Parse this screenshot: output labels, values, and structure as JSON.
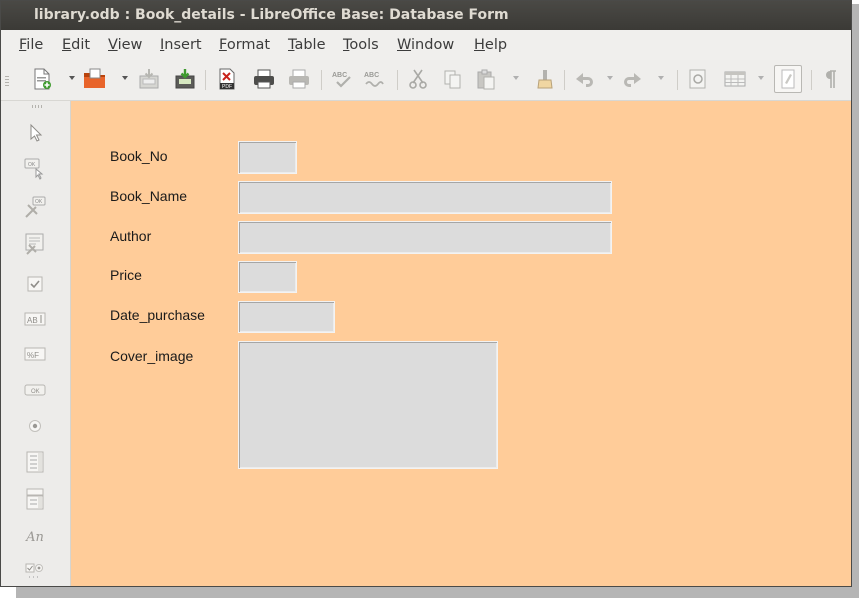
{
  "window": {
    "title": "library.odb : Book_details - LibreOffice Base: Database Form"
  },
  "menubar": {
    "items": [
      "File",
      "Edit",
      "View",
      "Insert",
      "Format",
      "Table",
      "Tools",
      "Window",
      "Help"
    ]
  },
  "toolbar": {
    "buttons": [
      "new-document",
      "open",
      "save",
      "save-export",
      "export-pdf",
      "print",
      "print-preview",
      "spellcheck",
      "autospellcheck",
      "cut",
      "copy",
      "paste",
      "clone-formatting",
      "undo",
      "redo",
      "navigator",
      "table",
      "draw-functions",
      "formatting-marks"
    ]
  },
  "sidebar": {
    "tools": [
      "select",
      "push-button",
      "design-mode",
      "form-navigator",
      "check-box",
      "text-box",
      "formatted-field",
      "button",
      "option-button",
      "list-box",
      "combo-box",
      "label-field",
      "more-controls"
    ],
    "label_tool_text": "An"
  },
  "form": {
    "background_color": "#ffcc99",
    "fields": [
      {
        "label": "Book_No",
        "value": ""
      },
      {
        "label": "Book_Name",
        "value": ""
      },
      {
        "label": "Author",
        "value": ""
      },
      {
        "label": "Price",
        "value": ""
      },
      {
        "label": "Date_purchase",
        "value": ""
      },
      {
        "label": "Cover_image",
        "value": ""
      }
    ]
  }
}
